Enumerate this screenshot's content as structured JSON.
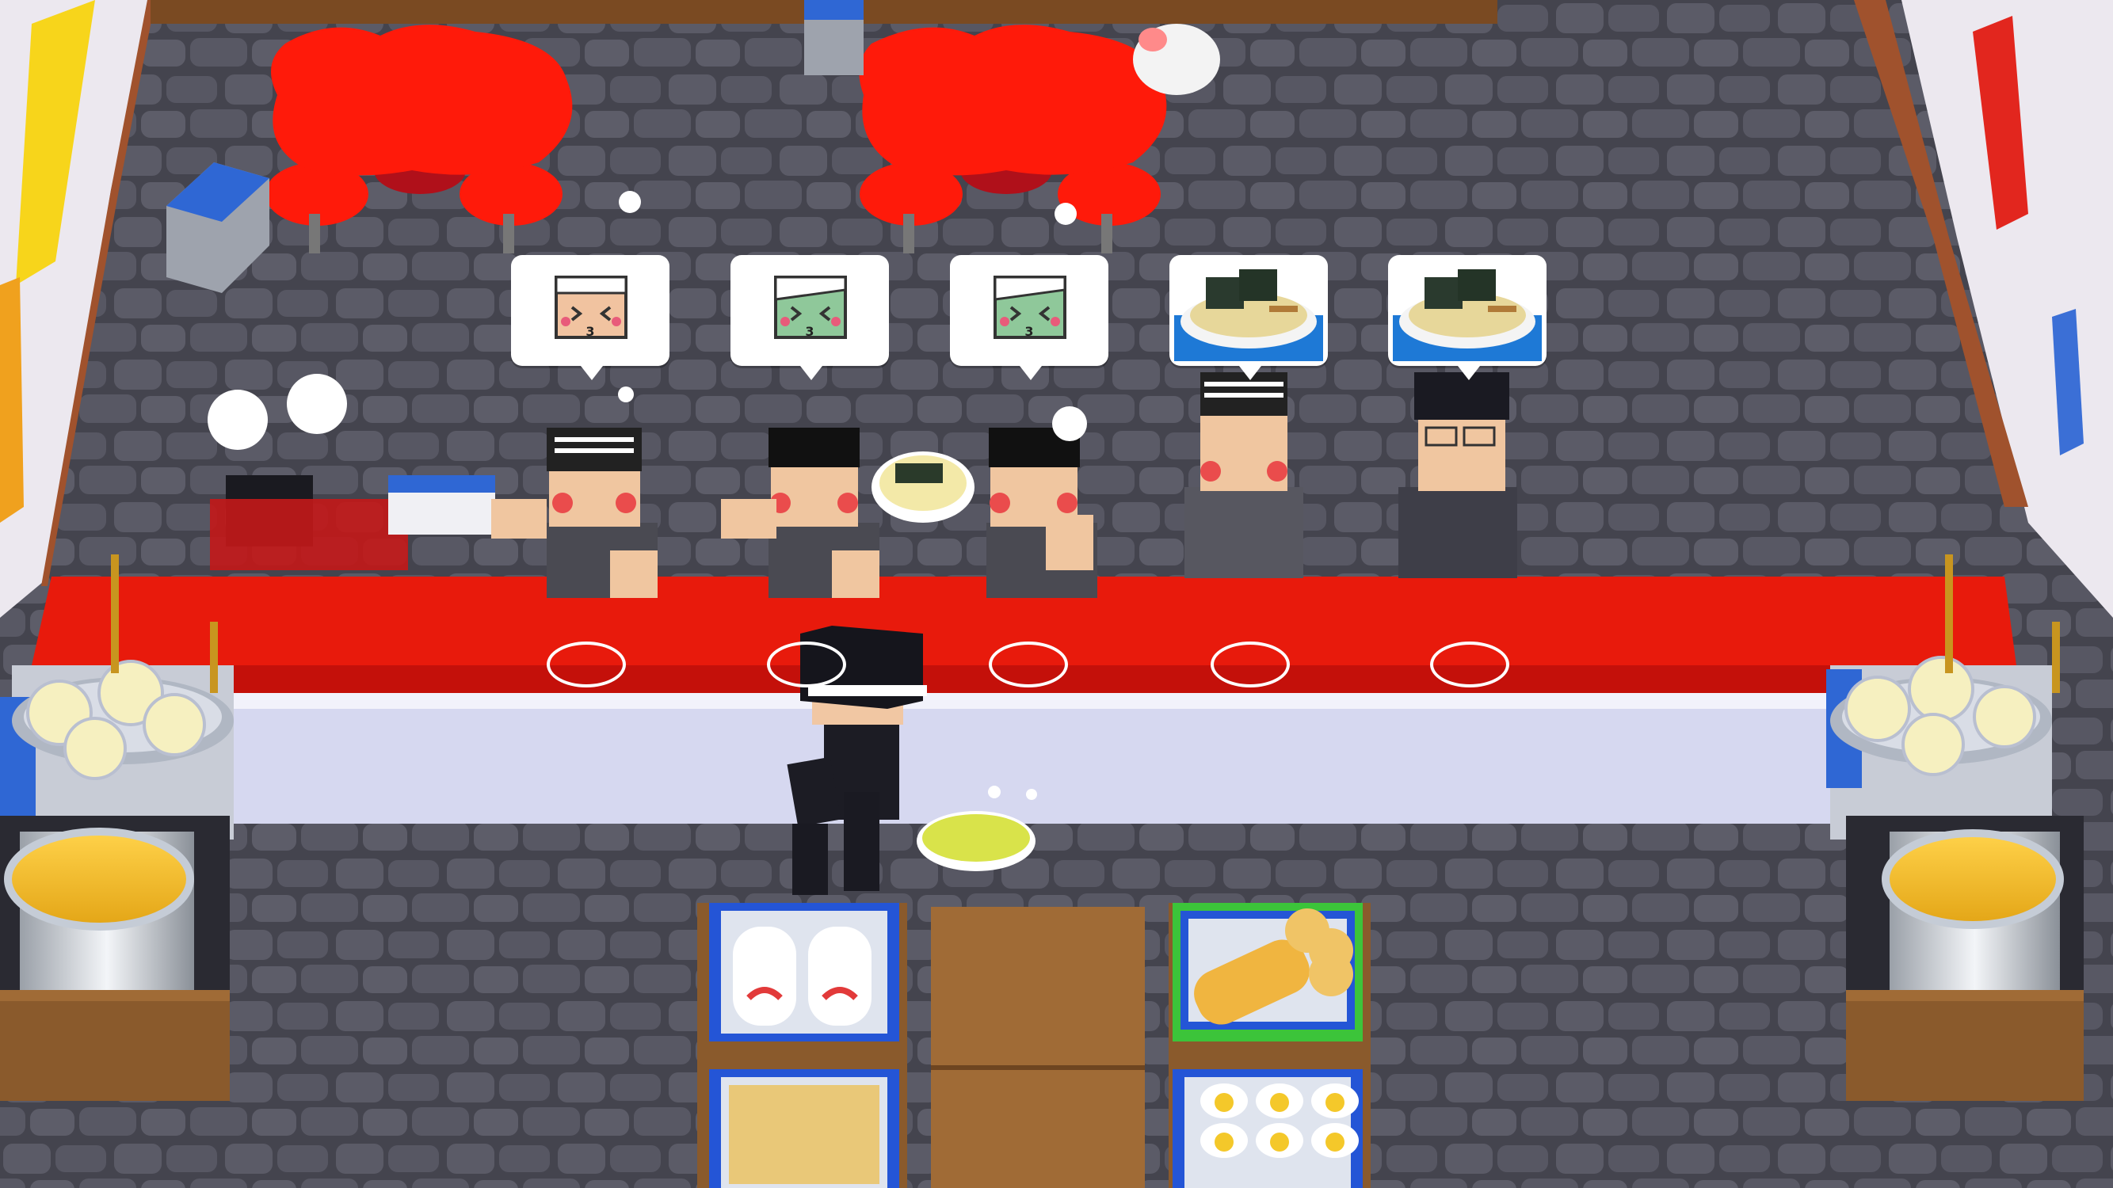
{
  "scene": {
    "title": "",
    "colors": {
      "floor": "#46464f",
      "stone": "#5a5a66",
      "counter_top": "#e81a0c",
      "counter_front": "#d5d7ef",
      "table": "#ff1a0a",
      "wall": "#e9e6ee",
      "wood": "#8a5a2c",
      "tray_blue": "#2455d6",
      "tray_green": "#3cc43a"
    }
  },
  "customers": [
    {
      "id": "customer-1",
      "mood": "angry",
      "bubble_icon": "angry-face-icon",
      "bubble_count": "3"
    },
    {
      "id": "customer-2",
      "mood": "angry",
      "bubble_icon": "angry-face-icon",
      "bubble_count": "3"
    },
    {
      "id": "customer-3",
      "mood": "angry",
      "bubble_icon": "angry-face-icon",
      "bubble_count": "3"
    },
    {
      "id": "customer-4",
      "mood": "waiting",
      "bubble_icon": "ramen-bowl-icon",
      "bubble_count": ""
    },
    {
      "id": "customer-5",
      "mood": "waiting",
      "bubble_icon": "ramen-bowl-icon",
      "bubble_count": ""
    }
  ],
  "seats": [
    "seat-1",
    "seat-2",
    "seat-3",
    "seat-4",
    "seat-5"
  ],
  "stations": {
    "left": [
      "noodle-strainer-basket-icon",
      "soup-pot-icon"
    ],
    "right": [
      "noodle-strainer-basket-icon",
      "soup-pot-icon"
    ],
    "ingredients": [
      "naruto-fishcake-icon",
      "chashu-pork-icon",
      "menma-bamboo-icon",
      "boiled-egg-icon"
    ]
  }
}
